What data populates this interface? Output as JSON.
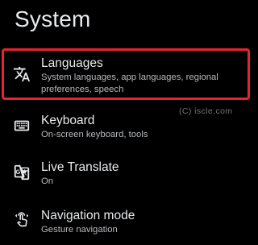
{
  "header": {
    "title": "System"
  },
  "items": [
    {
      "title": "Languages",
      "subtitle": "System languages, app languages, regional preferences, speech",
      "icon": "translate-icon"
    },
    {
      "title": "Keyboard",
      "subtitle": "On-screen keyboard, tools",
      "icon": "keyboard-icon"
    },
    {
      "title": "Live Translate",
      "subtitle": "On",
      "icon": "live-translate-icon"
    },
    {
      "title": "Navigation mode",
      "subtitle": "Gesture navigation",
      "icon": "gesture-icon"
    }
  ],
  "watermark": "(C) iscle.com",
  "colors": {
    "background": "#000000",
    "text": "#e8eaed",
    "subtext": "#b6b9bd",
    "highlight": "#e8232e"
  }
}
